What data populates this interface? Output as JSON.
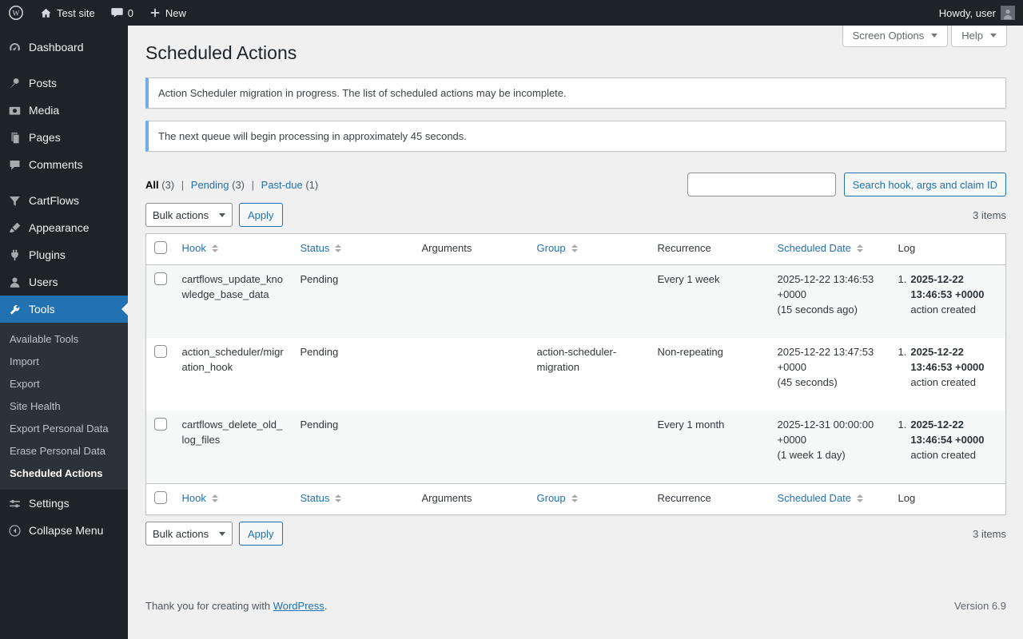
{
  "admin_bar": {
    "site_name": "Test site",
    "comments_count": "0",
    "new_label": "New",
    "howdy": "Howdy, user"
  },
  "screen_meta": {
    "screen_options_label": "Screen Options",
    "help_label": "Help"
  },
  "sidebar": {
    "items": [
      {
        "label": "Dashboard",
        "icon": "dashboard-icon"
      },
      {
        "label": "Posts",
        "icon": "pin-icon"
      },
      {
        "label": "Media",
        "icon": "camera-icon"
      },
      {
        "label": "Pages",
        "icon": "pages-icon"
      },
      {
        "label": "Comments",
        "icon": "comment-icon"
      },
      {
        "label": "CartFlows",
        "icon": "cartflows-funnel-icon"
      },
      {
        "label": "Appearance",
        "icon": "brush-icon"
      },
      {
        "label": "Plugins",
        "icon": "plugin-icon"
      },
      {
        "label": "Users",
        "icon": "user-icon"
      },
      {
        "label": "Tools",
        "icon": "wrench-icon"
      },
      {
        "label": "Settings",
        "icon": "sliders-icon"
      },
      {
        "label": "Collapse Menu",
        "icon": "collapse-arrow-icon"
      }
    ],
    "tools_submenu": [
      "Available Tools",
      "Import",
      "Export",
      "Site Health",
      "Export Personal Data",
      "Erase Personal Data",
      "Scheduled Actions"
    ]
  },
  "page": {
    "title": "Scheduled Actions"
  },
  "notices": [
    {
      "text": "Action Scheduler migration in progress. The list of scheduled actions may be incomplete."
    },
    {
      "text": "The next queue will begin processing in approximately 45 seconds."
    }
  ],
  "filters": {
    "all_label": "All",
    "all_count": "(3)",
    "pending_label": "Pending",
    "pending_count": "(3)",
    "pastdue_label": "Past-due",
    "pastdue_count": "(1)",
    "separator": "|"
  },
  "search": {
    "value": "",
    "button_label": "Search hook, args and claim ID"
  },
  "tablenav": {
    "bulk_actions_label": "Bulk actions",
    "apply_label": "Apply",
    "items_count": "3 items"
  },
  "table": {
    "headers": {
      "hook": "Hook",
      "status": "Status",
      "arguments": "Arguments",
      "group": "Group",
      "recurrence": "Recurrence",
      "scheduled_date": "Scheduled Date",
      "log": "Log"
    },
    "rows": [
      {
        "hook": "cartflows_update_knowledge_base_data",
        "status": "Pending",
        "arguments": "",
        "group": "",
        "recurrence": "Every 1 week",
        "scheduled": "2025-12-22 13:46:53 +0000",
        "scheduled_relative": "(15 seconds ago)",
        "log_num": "1.",
        "log_date": "2025-12-22 13:46:53 +0000",
        "log_text": "action created"
      },
      {
        "hook": "action_scheduler/migration_hook",
        "status": "Pending",
        "arguments": "",
        "group": "action-scheduler-migration",
        "recurrence": "Non-repeating",
        "scheduled": "2025-12-22 13:47:53 +0000",
        "scheduled_relative": "(45 seconds)",
        "log_num": "1.",
        "log_date": "2025-12-22 13:46:53 +0000",
        "log_text": "action created"
      },
      {
        "hook": "cartflows_delete_old_log_files",
        "status": "Pending",
        "arguments": "",
        "group": "",
        "recurrence": "Every 1 month",
        "scheduled": "2025-12-31 00:00:00 +0000",
        "scheduled_relative": "(1 week 1 day)",
        "log_num": "1.",
        "log_date": "2025-12-22 13:46:54 +0000",
        "log_text": "action created"
      }
    ]
  },
  "footer": {
    "thanks_prefix": "Thank you for creating with ",
    "wordpress_link": "WordPress",
    "thanks_suffix": ".",
    "version": "Version 6.9"
  },
  "colors": {
    "admin_dark": "#1d2327",
    "accent_blue": "#2271b1",
    "notice_border": "#72aee6",
    "content_bg": "#f0f0f1"
  }
}
